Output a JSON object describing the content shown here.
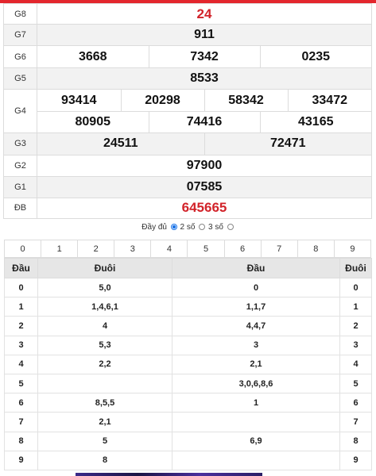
{
  "results": {
    "g8": {
      "label": "G8",
      "value": "24"
    },
    "g7": {
      "label": "G7",
      "value": "911"
    },
    "g6": {
      "label": "G6",
      "values": [
        "3668",
        "7342",
        "0235"
      ]
    },
    "g5": {
      "label": "G5",
      "value": "8533"
    },
    "g4": {
      "label": "G4",
      "row1": [
        "93414",
        "20298",
        "58342",
        "33472"
      ],
      "row2": [
        "80905",
        "74416",
        "43165"
      ]
    },
    "g3": {
      "label": "G3",
      "values": [
        "24511",
        "72471"
      ]
    },
    "g2": {
      "label": "G2",
      "value": "97900"
    },
    "g1": {
      "label": "G1",
      "value": "07585"
    },
    "db": {
      "label": "ĐB",
      "value": "645665"
    }
  },
  "options": {
    "full": "Đầy đủ",
    "two": "2 số",
    "three": "3 số",
    "selected": "two"
  },
  "digit_buttons": [
    "0",
    "1",
    "2",
    "3",
    "4",
    "5",
    "6",
    "7",
    "8",
    "9"
  ],
  "stats": {
    "headers": [
      "Đầu",
      "Đuôi",
      "Đầu",
      "Đuôi"
    ],
    "rows": [
      {
        "head": "0",
        "tail_list": "5,0",
        "head_list": "0",
        "tail": "0"
      },
      {
        "head": "1",
        "tail_list": "1,4,6,1",
        "head_list": "1,1,7",
        "tail": "1"
      },
      {
        "head": "2",
        "tail_list": "4",
        "head_list": "4,4,7",
        "tail": "2"
      },
      {
        "head": "3",
        "tail_list": "5,3",
        "head_list": "3",
        "tail": "3"
      },
      {
        "head": "4",
        "tail_list": "2,2",
        "head_list": "2,1",
        "tail": "4"
      },
      {
        "head": "5",
        "tail_list": "",
        "head_list": "3,0,6,8,6",
        "tail": "5"
      },
      {
        "head": "6",
        "tail_list": "8,5,5",
        "head_list": "1",
        "tail": "6"
      },
      {
        "head": "7",
        "tail_list": "2,1",
        "head_list": "",
        "tail": "7"
      },
      {
        "head": "8",
        "tail_list": "5",
        "head_list": "6,9",
        "tail": "8"
      },
      {
        "head": "9",
        "tail_list": "8",
        "head_list": "",
        "tail": "9"
      }
    ]
  },
  "colors": {
    "accent_red": "#d2232a",
    "radio_blue": "#1a73e8"
  }
}
